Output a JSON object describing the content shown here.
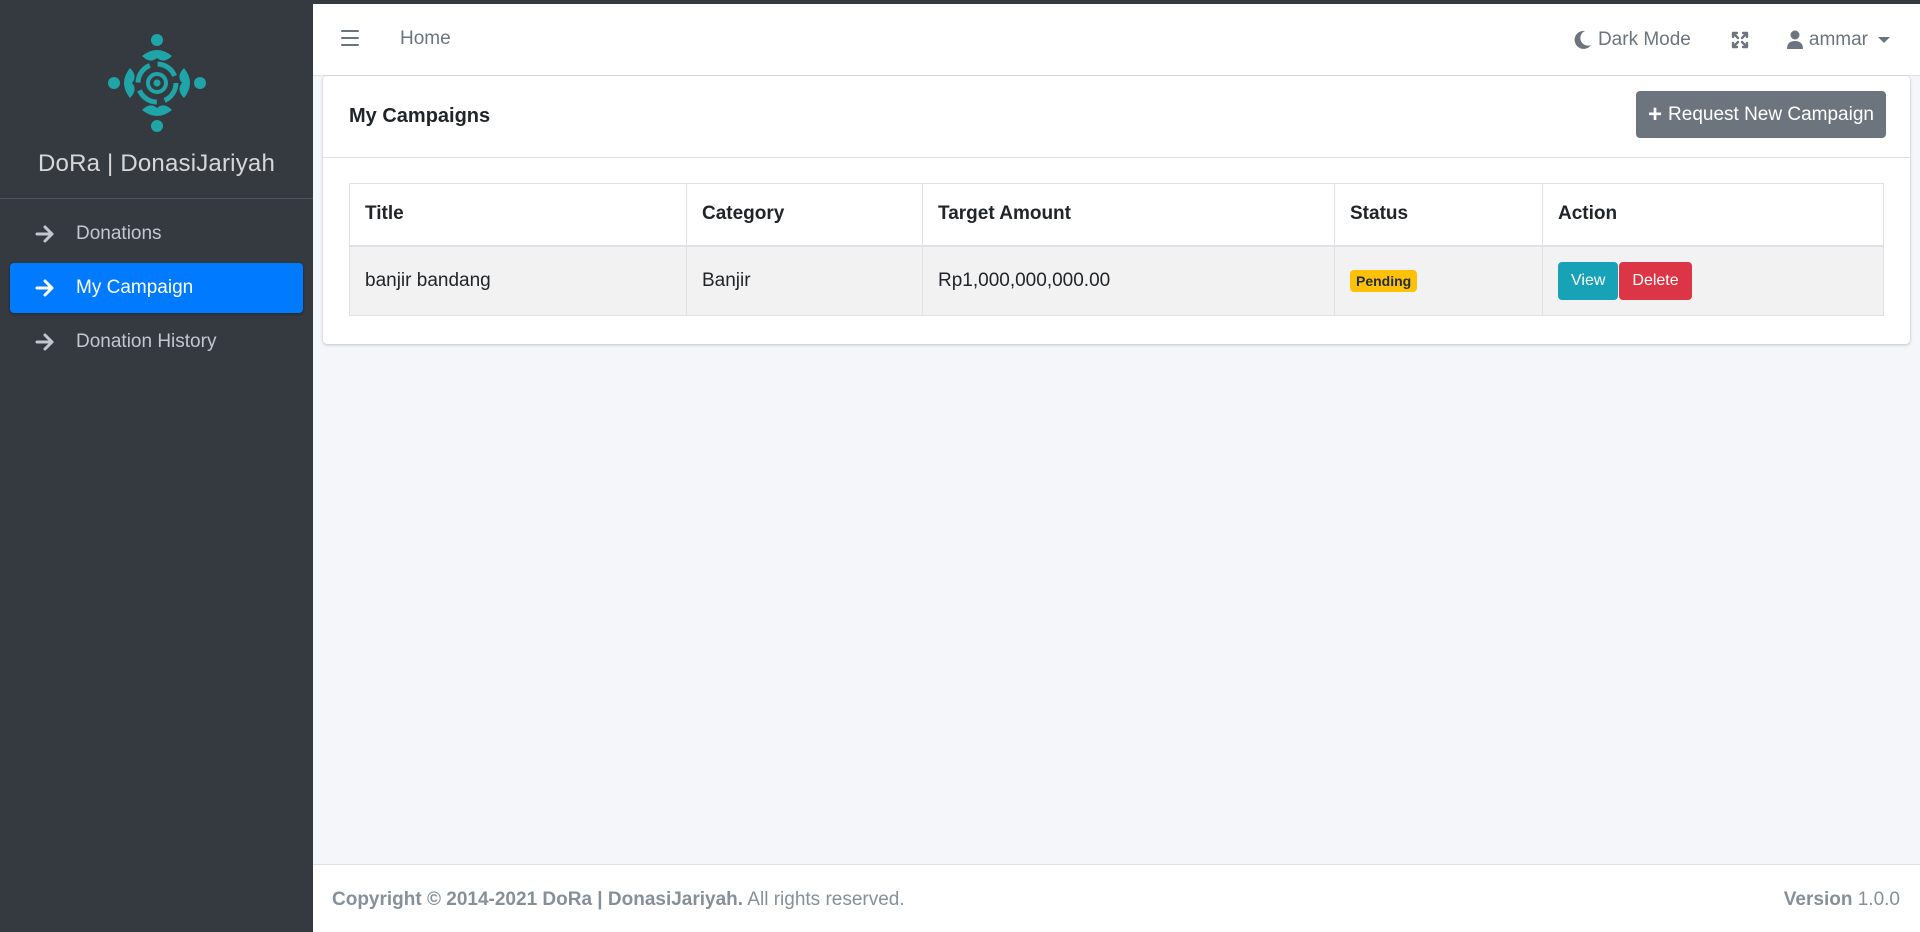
{
  "brand": {
    "name": "DoRa | DonasiJariyah",
    "logo_icon": "dora-logo-icon"
  },
  "sidebar": {
    "items": [
      {
        "label": "Donations",
        "active": false
      },
      {
        "label": "My Campaign",
        "active": true
      },
      {
        "label": "Donation History",
        "active": false
      }
    ]
  },
  "header": {
    "home_label": "Home",
    "dark_mode_label": "Dark Mode",
    "user_name": "ammar"
  },
  "card": {
    "title": "My Campaigns",
    "request_button_label": "Request New Campaign"
  },
  "table": {
    "columns": [
      "Title",
      "Category",
      "Target Amount",
      "Status",
      "Action"
    ],
    "rows": [
      {
        "title": "banjir bandang",
        "category": "Banjir",
        "target_amount": "Rp1,000,000,000.00",
        "status": "Pending",
        "view_label": "View",
        "delete_label": "Delete"
      }
    ]
  },
  "footer": {
    "copyright_bold": "Copyright © 2014-2021 DoRa | DonasiJariyah.",
    "copyright_rest": " All rights reserved.",
    "version_label": "Version",
    "version_value": " 1.0.0"
  },
  "colors": {
    "sidebar_bg": "#343a40",
    "active_blue": "#007bff",
    "view_teal": "#17a2b8",
    "delete_red": "#dc3545",
    "pending_yellow": "#ffc107",
    "logo_teal": "#1fa5a8"
  }
}
